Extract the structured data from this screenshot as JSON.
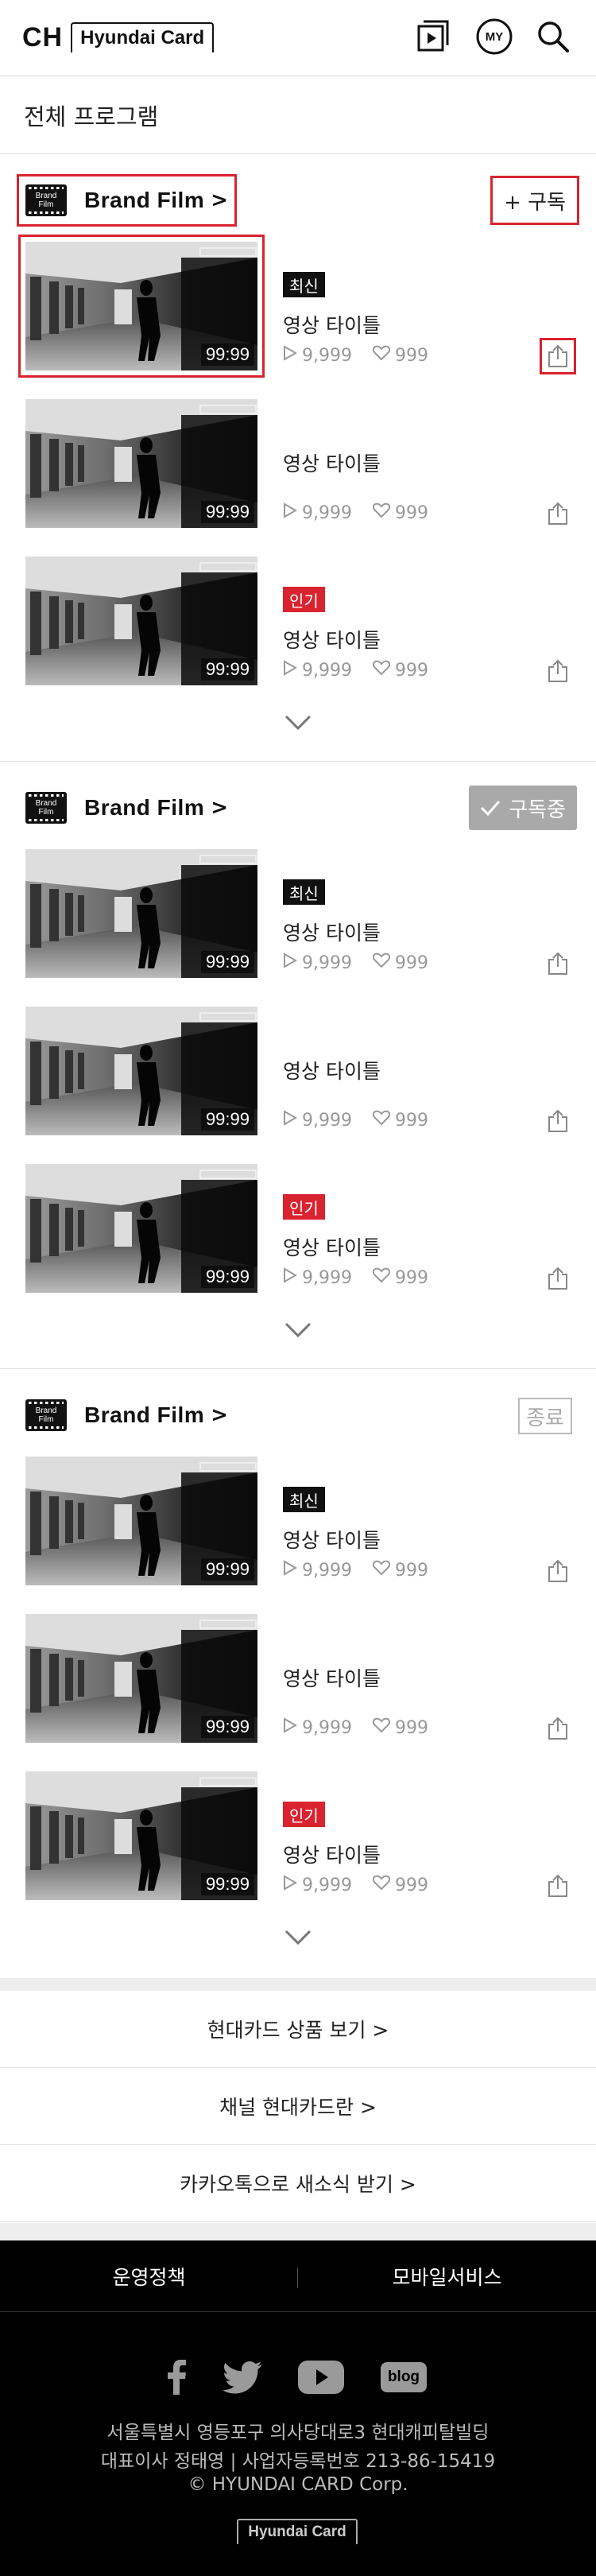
{
  "header": {
    "logo_ch": "CH",
    "logo_hyundai": "Hyundai Card",
    "my_label": "MY",
    "icons": [
      "play-list-icon",
      "my-icon",
      "search-icon"
    ]
  },
  "page_title": "전체 프로그램",
  "sections": [
    {
      "brand_icon_text": [
        "Brand",
        "Film"
      ],
      "brand_name": "Brand Film",
      "chevron": ">",
      "subscribe_label": "+ 구독",
      "items": [
        {
          "badge": "최신",
          "title": "영상 타이틀",
          "duration": "99:99",
          "views": "9,999",
          "likes": "999"
        },
        {
          "badge": "",
          "title": "영상 타이틀",
          "duration": "99:99",
          "views": "9,999",
          "likes": "999"
        },
        {
          "badge": "인기",
          "title": "영상 타이틀",
          "duration": "99:99",
          "views": "9,999",
          "likes": "999"
        }
      ]
    },
    {
      "brand_icon_text": [
        "Brand",
        "Film"
      ],
      "brand_name": "Brand Film",
      "chevron": ">",
      "subscribe_label": "구독중",
      "items": [
        {
          "badge": "최신",
          "title": "영상 타이틀",
          "duration": "99:99",
          "views": "9,999",
          "likes": "999"
        },
        {
          "badge": "",
          "title": "영상 타이틀",
          "duration": "99:99",
          "views": "9,999",
          "likes": "999"
        },
        {
          "badge": "인기",
          "title": "영상 타이틀",
          "duration": "99:99",
          "views": "9,999",
          "likes": "999"
        }
      ]
    },
    {
      "brand_icon_text": [
        "Brand",
        "Film"
      ],
      "brand_name": "Brand Film",
      "chevron": ">",
      "subscribe_label": "종료",
      "items": [
        {
          "badge": "최신",
          "title": "영상 타이틀",
          "duration": "99:99",
          "views": "9,999",
          "likes": "999"
        },
        {
          "badge": "",
          "title": "영상 타이틀",
          "duration": "99:99",
          "views": "9,999",
          "likes": "999"
        },
        {
          "badge": "인기",
          "title": "영상 타이틀",
          "duration": "99:99",
          "views": "9,999",
          "likes": "999"
        }
      ]
    }
  ],
  "links": [
    "현대카드 상품 보기 >",
    "채널 현대카드란 >",
    "카카오톡으로 새소식 받기 >"
  ],
  "footer": {
    "nav": [
      "운영정책",
      "모바일서비스"
    ],
    "social": [
      "facebook-icon",
      "twitter-icon",
      "youtube-icon",
      "blog-icon"
    ],
    "blog_label": "blog",
    "address_lines": [
      "서울특별시 영등포구 의사당대로3 현대캐피탈빌딩",
      "대표이사 정태영 | 사업자등록번호 213-86-15419",
      "© HYUNDAI CARD Corp."
    ],
    "logo_text": "Hyundai Card"
  },
  "colors": {
    "accent_red": "#d9232f",
    "subscribed_gray": "#a9a9a9",
    "footer_bg": "#000000"
  }
}
